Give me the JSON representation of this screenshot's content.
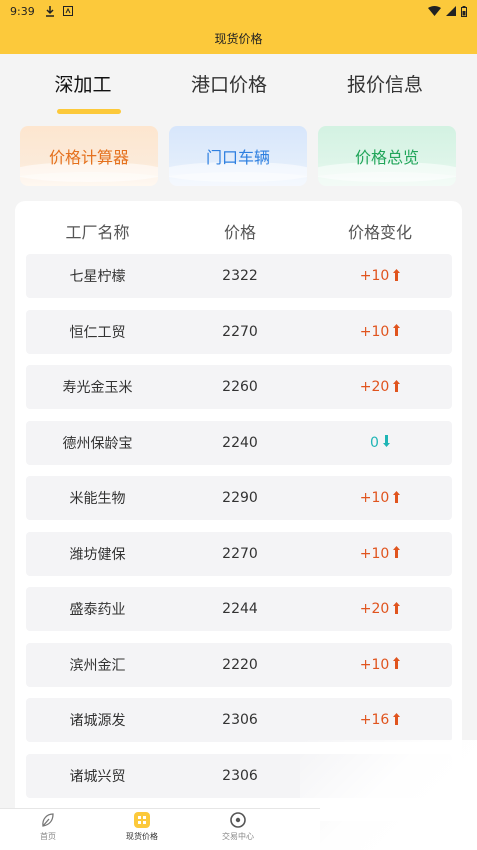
{
  "status": {
    "time": "9:39"
  },
  "appbar": {
    "title": "现货价格"
  },
  "tabs": [
    {
      "label": "深加工",
      "active": true
    },
    {
      "label": "港口价格",
      "active": false
    },
    {
      "label": "报价信息",
      "active": false
    }
  ],
  "quick_buttons": [
    {
      "label": "价格计算器",
      "color": "#e5711e"
    },
    {
      "label": "门口车辆",
      "color": "#2d7fe0"
    },
    {
      "label": "价格总览",
      "color": "#21a55a"
    }
  ],
  "table": {
    "headers": [
      "工厂名称",
      "价格",
      "价格变化"
    ],
    "rows": [
      {
        "name": "七星柠檬",
        "price": "2322",
        "change": "+10",
        "dir": "up"
      },
      {
        "name": "恒仁工贸",
        "price": "2270",
        "change": "+10",
        "dir": "up"
      },
      {
        "name": "寿光金玉米",
        "price": "2260",
        "change": "+20",
        "dir": "up"
      },
      {
        "name": "德州保龄宝",
        "price": "2240",
        "change": "0",
        "dir": "flat"
      },
      {
        "name": "米能生物",
        "price": "2290",
        "change": "+10",
        "dir": "up"
      },
      {
        "name": "潍坊健保",
        "price": "2270",
        "change": "+10",
        "dir": "up"
      },
      {
        "name": "盛泰药业",
        "price": "2244",
        "change": "+20",
        "dir": "up"
      },
      {
        "name": "滨州金汇",
        "price": "2220",
        "change": "+10",
        "dir": "up"
      },
      {
        "name": "诸城源发",
        "price": "2306",
        "change": "+16",
        "dir": "up"
      },
      {
        "name": "诸城兴贸",
        "price": "2306",
        "change": "",
        "dir": "none"
      }
    ]
  },
  "bottom_nav": [
    {
      "label": "首页",
      "icon": "leaf-icon",
      "active": false
    },
    {
      "label": "现货价格",
      "icon": "price-icon",
      "active": true
    },
    {
      "label": "交易中心",
      "icon": "trade-icon",
      "active": false
    }
  ]
}
